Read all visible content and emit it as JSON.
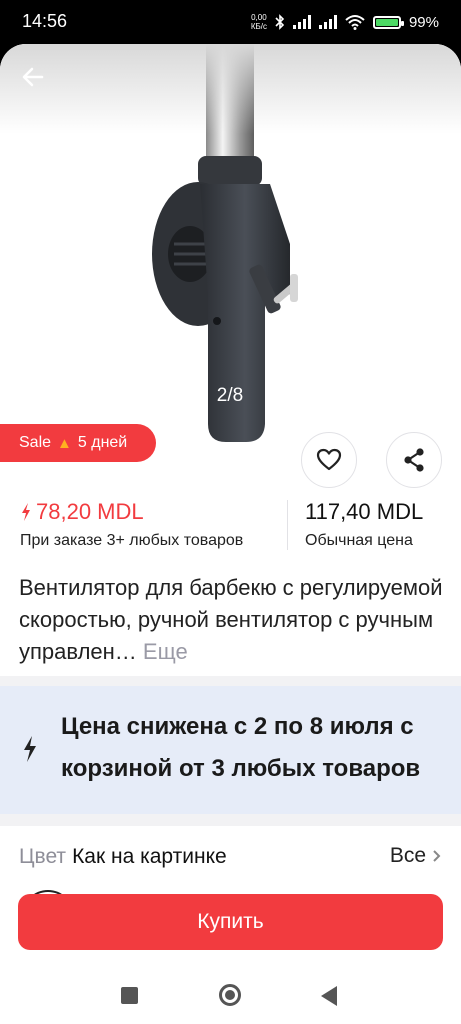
{
  "status_bar": {
    "time": "14:56",
    "net_speed_value": "0,00",
    "net_speed_unit": "КБ/с",
    "battery": "99%",
    "icons": [
      "bluetooth-icon",
      "signal-icon",
      "wifi-icon",
      "battery-icon"
    ]
  },
  "gallery": {
    "counter": "2/8",
    "current_image": 2,
    "total_images": 8
  },
  "sale_badge": {
    "label": "Sale",
    "days": "5 дней",
    "icon": "flame-icon"
  },
  "price": {
    "promo": "78,20 MDL",
    "promo_note": "При заказе 3+ любых товаров",
    "regular": "117,40 MDL",
    "regular_note": "Обычная цена"
  },
  "product": {
    "title": "Вентилятор для барбекю с регулируемой скоростью, ручной вентилятор с ручным управлен…",
    "more": "Еще"
  },
  "promo_banner": {
    "text": "Цена снижена с 2 по 8 июля с корзиной от 3 любых товаров",
    "icon": "lightning-icon"
  },
  "options": {
    "label": "Цвет",
    "value": "Как на картинке",
    "all_link": "Все"
  },
  "buy_button": {
    "label": "Купить"
  },
  "colors": {
    "accent": "#f23b3f",
    "banner_bg": "#e6ecf8",
    "muted_text": "#8e8e98"
  }
}
